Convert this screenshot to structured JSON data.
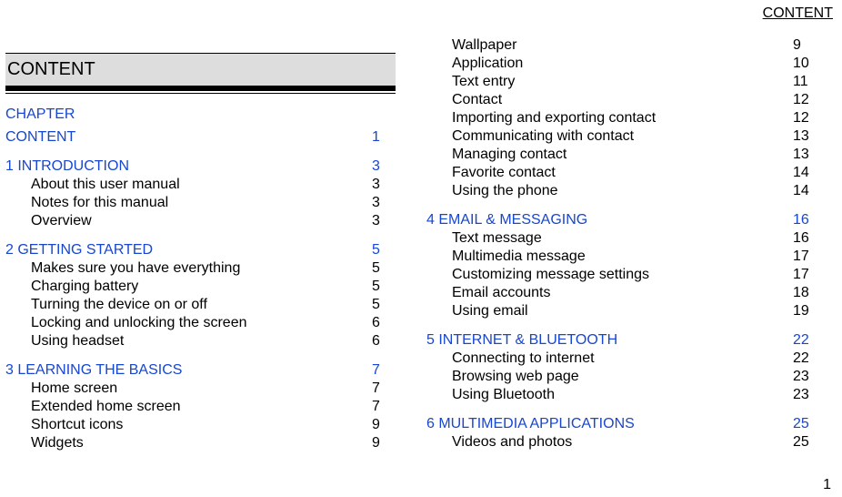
{
  "header": {
    "label": "CONTENT"
  },
  "footer": {
    "page_number": "1"
  },
  "title": {
    "text": "CONTENT"
  },
  "chapter_label": "CHAPTER",
  "first_chapter": {
    "name": "CONTENT",
    "page": "1"
  },
  "chapters_left": [
    {
      "name": "1 INTRODUCTION",
      "page": "3",
      "subs": [
        {
          "name": "About this user manual",
          "page": "3"
        },
        {
          "name": "Notes for this manual",
          "page": "3"
        },
        {
          "name": "Overview",
          "page": "3"
        }
      ]
    },
    {
      "name": "2 GETTING STARTED",
      "page": "5",
      "subs": [
        {
          "name": "Makes sure you have everything",
          "page": "5"
        },
        {
          "name": "Charging battery",
          "page": "5"
        },
        {
          "name": "Turning the device on or off",
          "page": "5"
        },
        {
          "name": "Locking and unlocking the screen",
          "page": "6"
        },
        {
          "name": "Using headset",
          "page": "6"
        }
      ]
    },
    {
      "name": "3 LEARNING THE BASICS",
      "page": "7",
      "subs": [
        {
          "name": "Home screen",
          "page": "7"
        },
        {
          "name": "Extended home screen",
          "page": "7"
        },
        {
          "name": "Shortcut icons",
          "page": "9"
        },
        {
          "name": "Widgets",
          "page": "9"
        }
      ]
    }
  ],
  "right_continuation_subs": [
    {
      "name": "Wallpaper",
      "page": "9"
    },
    {
      "name": "Application",
      "page": "10"
    },
    {
      "name": "Text entry",
      "page": "11"
    },
    {
      "name": "Contact",
      "page": "12"
    },
    {
      "name": "Importing and exporting contact",
      "page": "12"
    },
    {
      "name": "Communicating with contact",
      "page": "13"
    },
    {
      "name": "Managing contact",
      "page": "13"
    },
    {
      "name": "Favorite contact",
      "page": "14"
    },
    {
      "name": "Using the phone",
      "page": "14"
    }
  ],
  "chapters_right": [
    {
      "name": "4 EMAIL & MESSAGING",
      "page": "16",
      "subs": [
        {
          "name": "Text message",
          "page": "16"
        },
        {
          "name": "Multimedia message",
          "page": "17"
        },
        {
          "name": "Customizing message settings",
          "page": "17"
        },
        {
          "name": "Email accounts",
          "page": "18"
        },
        {
          "name": "Using email",
          "page": "19"
        }
      ]
    },
    {
      "name": "5 INTERNET & BLUETOOTH",
      "page": "22",
      "subs": [
        {
          "name": "Connecting to internet",
          "page": "22"
        },
        {
          "name": "Browsing web page",
          "page": "23"
        },
        {
          "name": "Using Bluetooth",
          "page": "23"
        }
      ]
    },
    {
      "name": "6 MULTIMEDIA APPLICATIONS",
      "page": "25",
      "subs": [
        {
          "name": "Videos and photos",
          "page": "25"
        }
      ]
    }
  ]
}
